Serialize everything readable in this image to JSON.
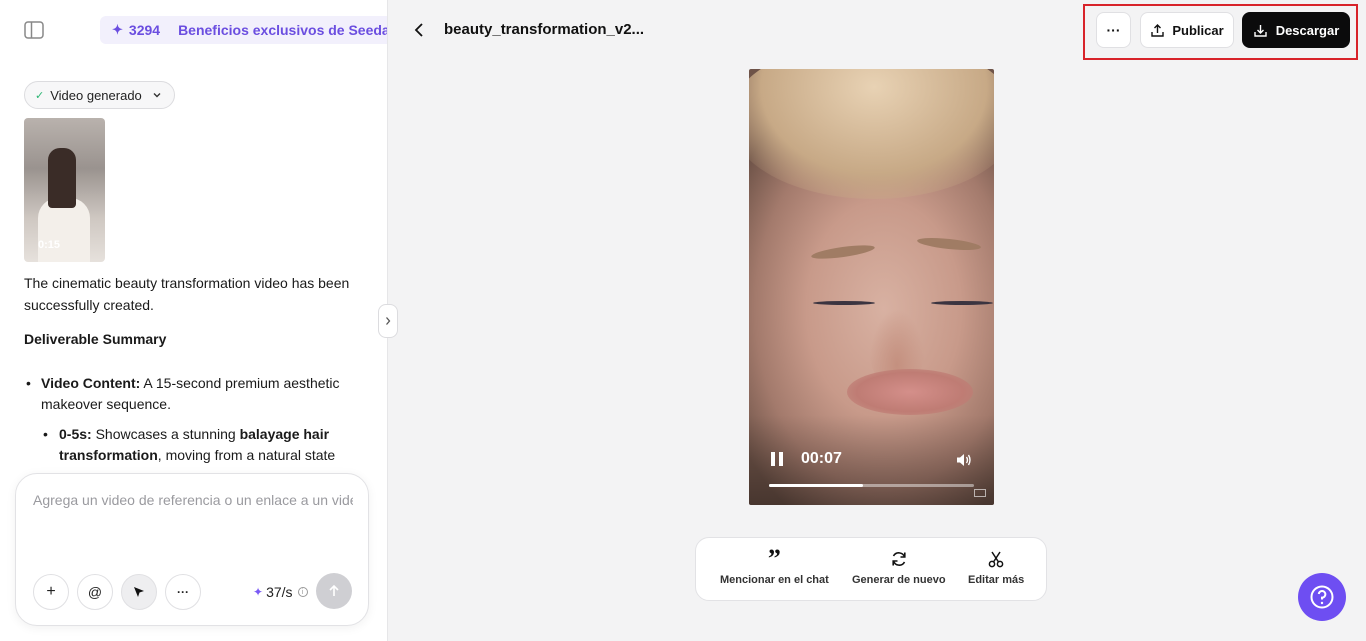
{
  "left_panel": {
    "credits": {
      "count": "3294",
      "label": "Beneficios exclusivos de Seedance"
    },
    "status_chip": "Video generado",
    "thumbnail": {
      "duration": "0:15"
    },
    "chat": {
      "intro": "The cinematic beauty transformation video has been successfully created.",
      "heading": "Deliverable Summary",
      "bullet1_label": "Video Content:",
      "bullet1_text": " A 15-second premium aesthetic makeover sequence.",
      "sub1_label": "0-5s:",
      "sub1_text_a": " Showcases a stunning ",
      "sub1_bold_a": "balayage hair transformation",
      "sub1_text_b": ", moving from a natural state"
    },
    "composer": {
      "placeholder": "Agrega un video de referencia o un enlace a un video",
      "plus": "+",
      "mention": "@",
      "more": "···",
      "rate": "37/s",
      "info": "i"
    }
  },
  "header": {
    "file_title": "beauty_transformation_v2...",
    "more_label": "···",
    "publish_label": "Publicar",
    "download_label": "Descargar"
  },
  "player": {
    "current_time": "00:07",
    "progress": 0.46
  },
  "toolbar": {
    "mention_icon": "”",
    "mention_label": "Mencionar en el chat",
    "regenerate_label": "Generar de nuevo",
    "edit_label": "Editar más"
  },
  "colors": {
    "accent": "#6e4ef2",
    "highlight_box": "#d8232a",
    "download_bg": "#0b0b0c"
  }
}
